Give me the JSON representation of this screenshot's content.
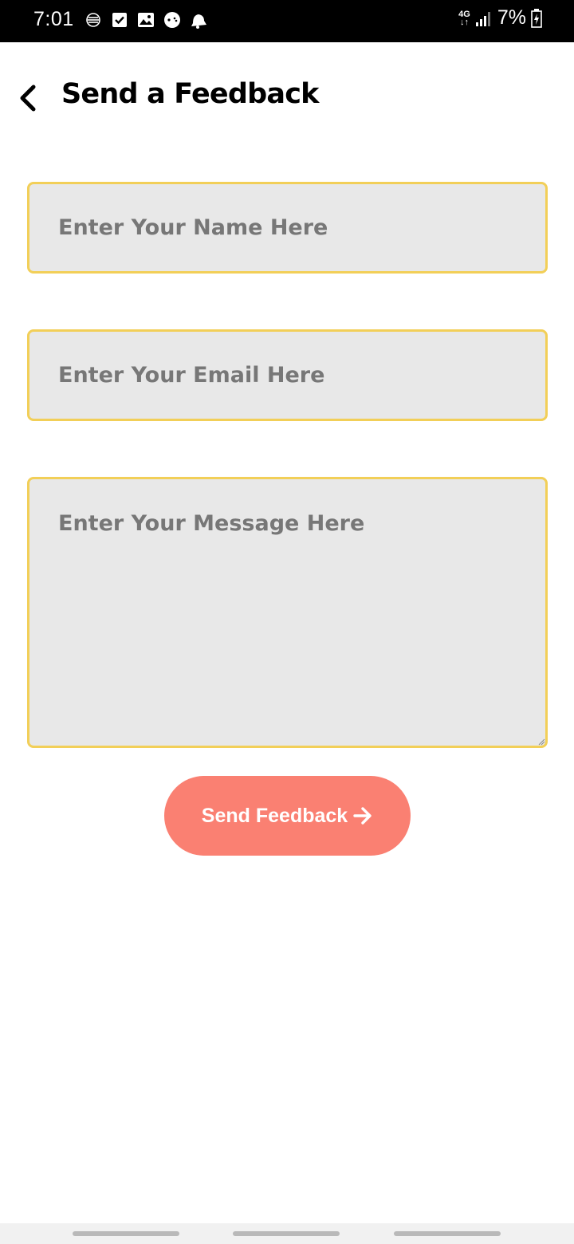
{
  "status_bar": {
    "time": "7:01",
    "network": "4G",
    "battery": "7%",
    "icons": [
      "notification-icon",
      "check-icon",
      "gallery-icon",
      "game-icon",
      "bell-icon",
      "signal-icon",
      "battery-icon"
    ]
  },
  "header": {
    "title": "Send a Feedback",
    "back_icon": "chevron-left-icon"
  },
  "form": {
    "name_placeholder": "Enter Your Name Here",
    "email_placeholder": "Enter Your Email Here",
    "message_placeholder": "Enter Your Message Here",
    "send_label": "Send Feedback",
    "send_icon": "arrow-right-icon"
  },
  "colors": {
    "field_background": "#e8e8e8",
    "field_border": "#f2cf58",
    "placeholder_text": "#777777",
    "button_background": "#fa8072",
    "button_text": "#ffffff",
    "status_bar": "#000000"
  }
}
